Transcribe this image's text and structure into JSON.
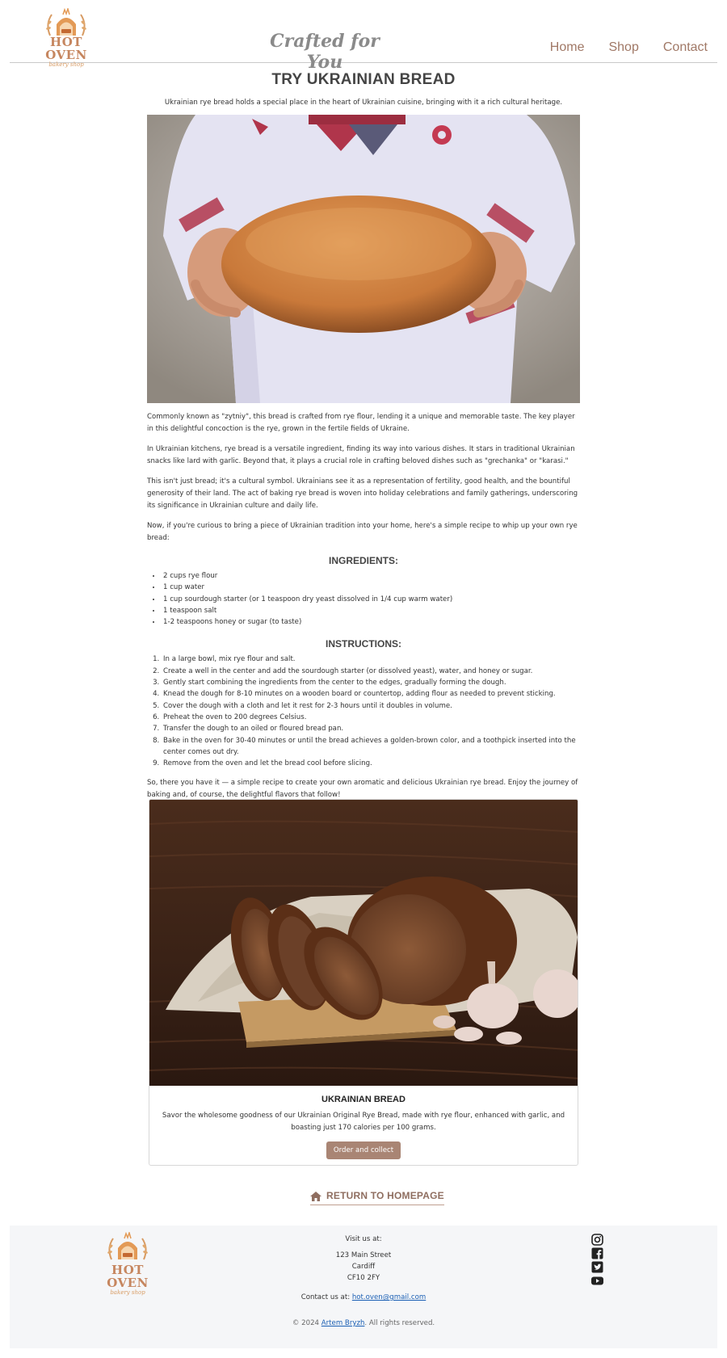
{
  "header": {
    "logo_name": "HOT OVEN",
    "logo_sub": "bakery shop",
    "tagline": "Crafted for You",
    "nav": [
      "Home",
      "Shop",
      "Contact"
    ]
  },
  "main": {
    "title": "TRY UKRAINIAN BREAD",
    "intro": "Ukrainian rye bread holds a special place in the heart of Ukrainian cuisine, bringing with it a rich cultural heritage.",
    "paragraphs": [
      "Commonly known as \"zytniy\", this bread is crafted from rye flour, lending it a unique and memorable taste. The key player in this delightful concoction is the rye, grown in the fertile fields of Ukraine.",
      "In Ukrainian kitchens, rye bread is a versatile ingredient, finding its way into various dishes. It stars in traditional Ukrainian snacks like lard with garlic. Beyond that, it plays a crucial role in crafting beloved dishes such as \"grechanka\" or \"karasi.\"",
      "This isn't just bread; it's a cultural symbol. Ukrainians see it as a representation of fertility, good health, and the bountiful generosity of their land. The act of baking rye bread is woven into holiday celebrations and family gatherings, underscoring its significance in Ukrainian culture and daily life.",
      "Now, if you're curious to bring a piece of Ukrainian tradition into your home, here's a simple recipe to whip up your own rye bread:"
    ],
    "ingredients_heading": "INGREDIENTS:",
    "ingredients": [
      "2 cups rye flour",
      "1 cup water",
      "1 cup sourdough starter (or 1 teaspoon dry yeast dissolved in 1/4 cup warm water)",
      "1 teaspoon salt",
      "1-2 teaspoons honey or sugar (to taste)"
    ],
    "instructions_heading": "INSTRUCTIONS:",
    "instructions": [
      "In a large bowl, mix rye flour and salt.",
      "Create a well in the center and add the sourdough starter (or dissolved yeast), water, and honey or sugar.",
      "Gently start combining the ingredients from the center to the edges, gradually forming the dough.",
      "Knead the dough for 8-10 minutes on a wooden board or countertop, adding flour as needed to prevent sticking.",
      "Cover the dough with a cloth and let it rest for 2-3 hours until it doubles in volume.",
      "Preheat the oven to 200 degrees Celsius.",
      "Transfer the dough to an oiled or floured bread pan.",
      "Bake in the oven for 30-40 minutes or until the bread achieves a golden-brown color, and a toothpick inserted into the center comes out dry.",
      "Remove from the oven and let the bread cool before slicing."
    ],
    "closing": "So, there you have it — a simple recipe to create your own aromatic and delicious Ukrainian rye bread. Enjoy the journey of baking and, of course, the delightful flavors that follow!"
  },
  "card": {
    "title": "UKRAINIAN BREAD",
    "text": "Savor the wholesome goodness of our Ukrainian Original Rye Bread, made with rye flour, enhanced with garlic, and boasting just 170 calories per 100 grams.",
    "button": "Order and collect"
  },
  "return_link": "RETURN TO HOMEPAGE",
  "footer": {
    "visit_label": "Visit us at:",
    "address": [
      "123 Main Street",
      "Cardiff",
      "CF10 2FY"
    ],
    "contact_prefix": "Contact us at:",
    "email": "hot.oven@gmail.com",
    "copy_prefix": "© 2024",
    "copy_author": "Artem Bryzh",
    "copy_suffix": ". All rights reserved.",
    "social_icons": [
      "instagram-icon",
      "facebook-icon",
      "twitter-icon",
      "youtube-icon"
    ]
  },
  "colors": {
    "accent": "#a98574",
    "nav": "#a07866",
    "logo": "#c6865f"
  }
}
